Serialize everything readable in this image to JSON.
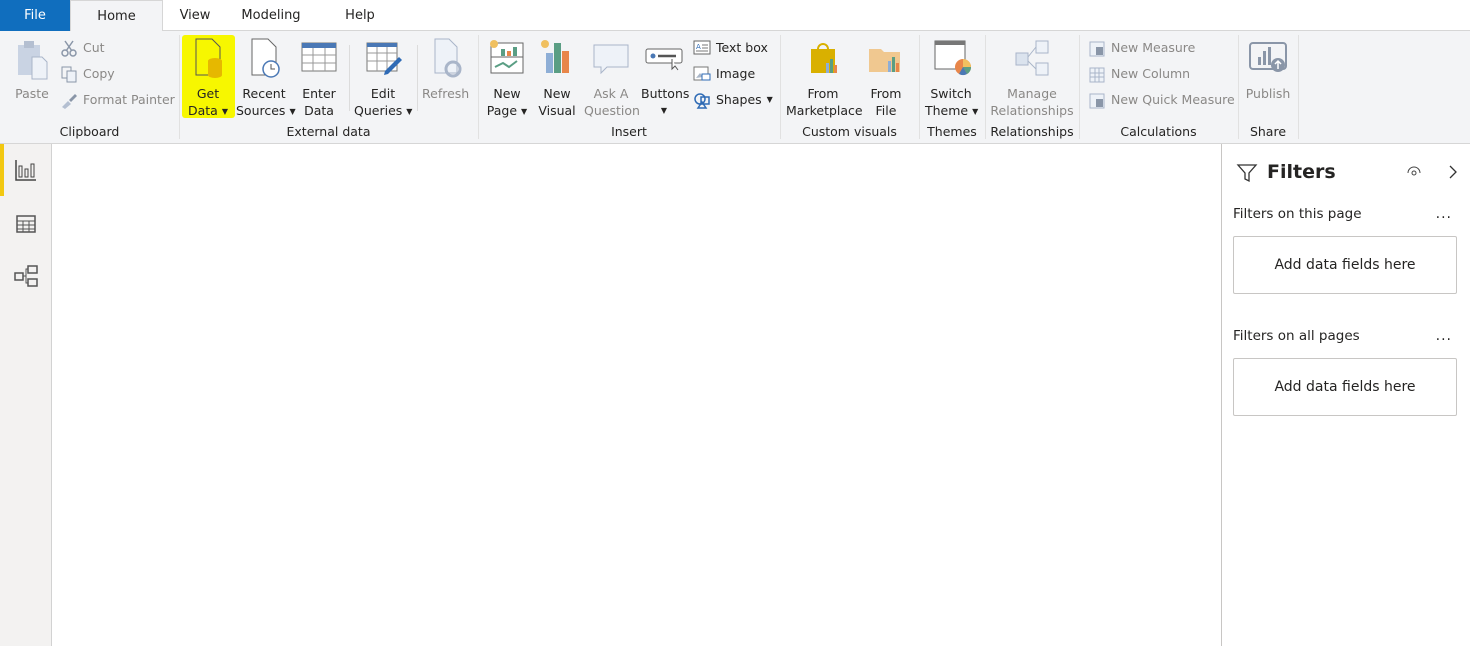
{
  "tabs": {
    "file": "File",
    "home": "Home",
    "view": "View",
    "modeling": "Modeling",
    "help": "Help"
  },
  "ribbon": {
    "clipboard": {
      "label": "Clipboard",
      "paste": "Paste",
      "cut": "Cut",
      "copy": "Copy",
      "format_painter": "Format Painter"
    },
    "external_data": {
      "label": "External data",
      "get_data": [
        "Get",
        "Data"
      ],
      "recent_sources": [
        "Recent",
        "Sources"
      ],
      "enter_data": [
        "Enter",
        "Data"
      ],
      "edit_queries": [
        "Edit",
        "Queries"
      ],
      "refresh": "Refresh"
    },
    "insert": {
      "label": "Insert",
      "new_page": [
        "New",
        "Page"
      ],
      "new_visual": [
        "New",
        "Visual"
      ],
      "ask_question": [
        "Ask A",
        "Question"
      ],
      "buttons": "Buttons",
      "text_box": "Text box",
      "image": "Image",
      "shapes": "Shapes"
    },
    "custom_visuals": {
      "label": "Custom visuals",
      "from_marketplace": [
        "From",
        "Marketplace"
      ],
      "from_file": [
        "From",
        "File"
      ]
    },
    "themes": {
      "label": "Themes",
      "switch_theme": [
        "Switch",
        "Theme"
      ]
    },
    "relationships": {
      "label": "Relationships",
      "manage": [
        "Manage",
        "Relationships"
      ]
    },
    "calculations": {
      "label": "Calculations",
      "new_measure": "New Measure",
      "new_column": "New Column",
      "new_quick_measure": "New Quick Measure"
    },
    "share": {
      "label": "Share",
      "publish": "Publish"
    }
  },
  "highlight_color": "#f7f700",
  "filters": {
    "title": "Filters",
    "this_page": "Filters on this page",
    "all_pages": "Filters on all pages",
    "drop_this_page": "Add data fields here",
    "drop_all_pages": "Add data fields here",
    "more": "..."
  }
}
